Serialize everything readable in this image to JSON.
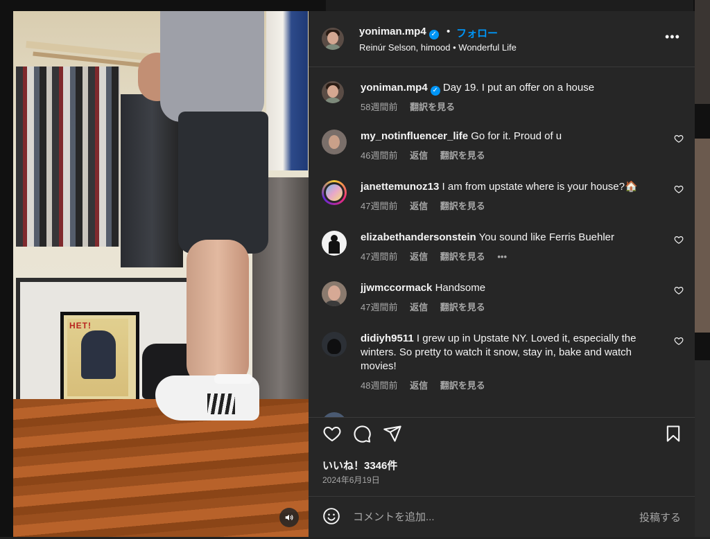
{
  "header": {
    "username": "yoniman.mp4",
    "verified_mark": "✓",
    "separator": "•",
    "follow_label": "フォロー",
    "audio_line": "Reinúr Selson, himood • Wonderful Life",
    "more_label": "•••"
  },
  "caption": {
    "username": "yoniman.mp4",
    "text": "Day 19. I put an offer on a house",
    "time": "58週間前",
    "translate": "翻訳を見る"
  },
  "comments": [
    {
      "username": "my_notinfluencer_life",
      "text": "Go for it. Proud of u",
      "time": "46週間前",
      "reply": "返信",
      "translate": "翻訳を見る"
    },
    {
      "username": "janettemunoz13",
      "text": "I am from upstate where is your house?🏠",
      "time": "47週間前",
      "reply": "返信",
      "translate": "翻訳を見る"
    },
    {
      "username": "elizabethandersonstein",
      "text": "You sound like Ferris Buehler",
      "time": "47週間前",
      "reply": "返信",
      "translate": "翻訳を見る",
      "more": "•••"
    },
    {
      "username": "jjwmccormack",
      "text": "Handsome",
      "time": "47週間前",
      "reply": "返信",
      "translate": "翻訳を見る"
    },
    {
      "username": "didiyh9511",
      "text": "I grew up in Upstate NY. Loved it, especially the winters. So pretty to watch it snow, stay in, bake and watch movies!",
      "time": "48週間前",
      "reply": "返信",
      "translate": "翻訳を見る"
    }
  ],
  "likes_text": "いいね！3346件",
  "date_text": "2024年6月19日",
  "comment_box": {
    "placeholder": "コメントを追加...",
    "post_label": "投稿する"
  },
  "poster_text": "HET!",
  "icons": [
    "heart-icon",
    "comment-icon",
    "share-icon",
    "bookmark-icon",
    "emoji-icon",
    "sound-icon",
    "small-heart-icon",
    "verified-icon",
    "more-icon"
  ],
  "colors": {
    "panel_bg": "#262626",
    "link_blue": "#0095f6",
    "muted_text": "#a8a8a8",
    "text": "#f5f5f5"
  }
}
